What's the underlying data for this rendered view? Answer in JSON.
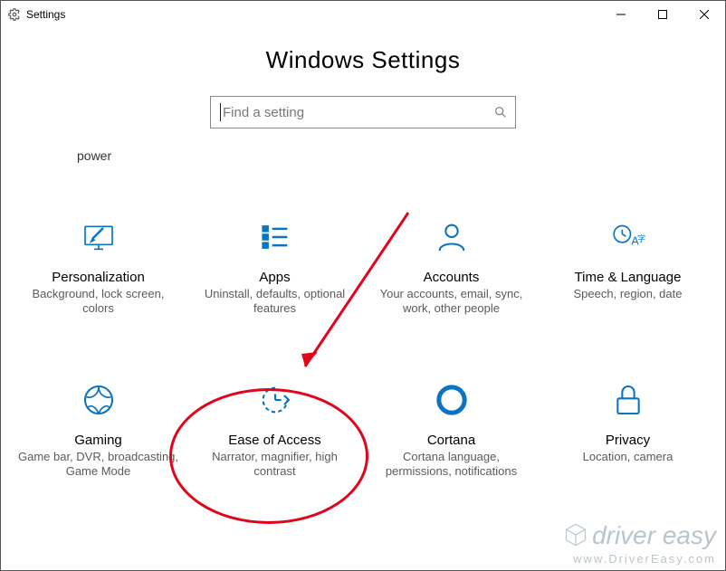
{
  "window": {
    "title": "Settings"
  },
  "page": {
    "heading": "Windows Settings",
    "search_placeholder": "Find a setting",
    "hint": "power"
  },
  "tiles": [
    {
      "title": "Personalization",
      "desc": "Background, lock screen, colors"
    },
    {
      "title": "Apps",
      "desc": "Uninstall, defaults, optional features"
    },
    {
      "title": "Accounts",
      "desc": "Your accounts, email, sync, work, other people"
    },
    {
      "title": "Time & Language",
      "desc": "Speech, region, date"
    },
    {
      "title": "Gaming",
      "desc": "Game bar, DVR, broadcasting, Game Mode"
    },
    {
      "title": "Ease of Access",
      "desc": "Narrator, magnifier, high contrast"
    },
    {
      "title": "Cortana",
      "desc": "Cortana language, permissions, notifications"
    },
    {
      "title": "Privacy",
      "desc": "Location, camera"
    }
  ],
  "watermark": {
    "line1": "driver easy",
    "line2": "www.DriverEasy.com"
  },
  "colors": {
    "accent": "#0a73c4",
    "annotation": "#e2041b"
  }
}
